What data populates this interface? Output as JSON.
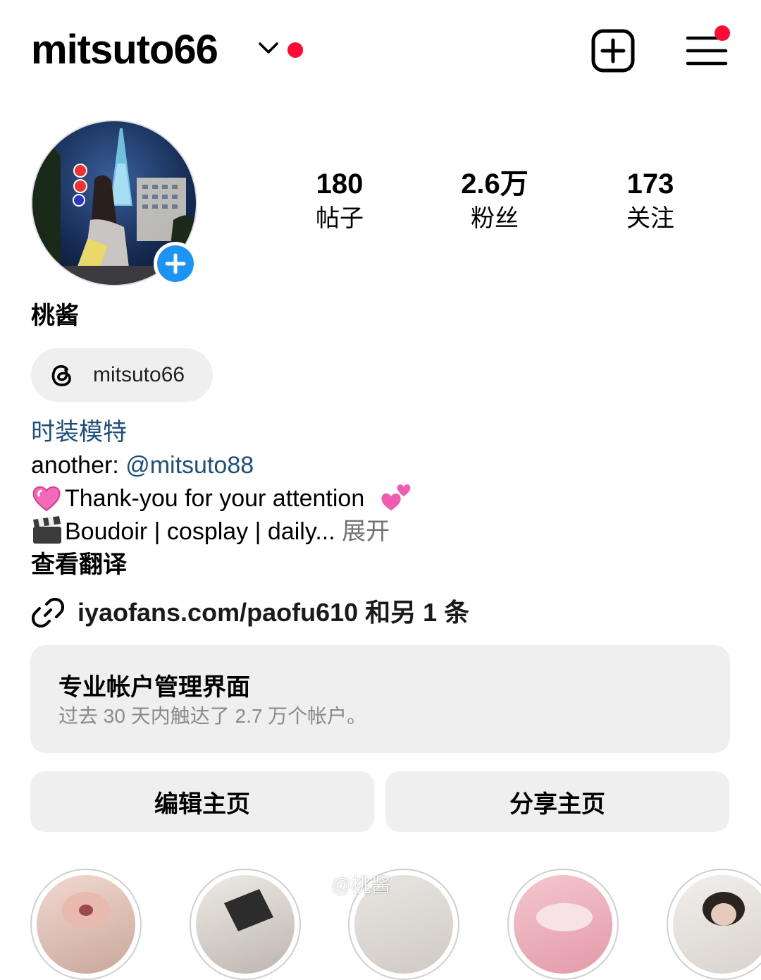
{
  "header": {
    "username": "mitsuto66",
    "add_icon": "plus-square-icon",
    "menu_icon": "hamburger-menu-icon",
    "notification_color": "#ff0a36"
  },
  "profile": {
    "avatar_icon": "add-story-plus-icon",
    "stats": [
      {
        "value": "180",
        "label": "帖子"
      },
      {
        "value": "2.6万",
        "label": "粉丝"
      },
      {
        "value": "173",
        "label": "关注"
      }
    ],
    "display_name": "桃酱",
    "threads_handle": "mitsuto66",
    "category": "时装模特",
    "bio": {
      "line1_prefix": "another: ",
      "line1_mention": "@mitsuto88",
      "line2": "Thank-you for your attention",
      "line3": "Boudoir | cosplay | daily...",
      "expand": "展开",
      "translate": "查看翻译"
    },
    "link": "iyaofans.com/paofu610 和另 1 条"
  },
  "dashboard": {
    "title": "专业帐户管理界面",
    "subtitle": "过去 30 天内触达了 2.7 万个帐户。"
  },
  "actions": {
    "edit": "编辑主页",
    "share": "分享主页"
  },
  "watermark": "@桃酱",
  "accent_color": "#1d93f3"
}
